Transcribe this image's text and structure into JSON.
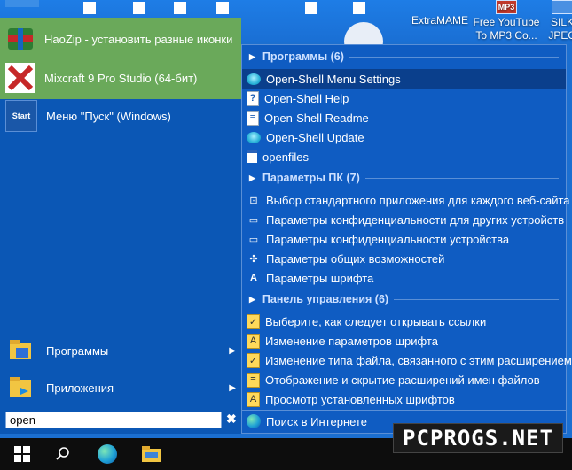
{
  "desktop": {
    "icons": [
      {
        "label": "ExtraMAME",
        "icon": "extramame-icon"
      },
      {
        "label": "Free YouTube To MP3 Co...",
        "icon": "mp3-icon"
      },
      {
        "label": "SILK JPEG P",
        "icon": "silk-icon"
      }
    ],
    "mp3_badge": "MP3"
  },
  "start_menu": {
    "pinned": [
      {
        "label": "HaoZip - установить разные иконки",
        "icon": "haozip-icon"
      },
      {
        "label": "Mixcraft 9 Pro Studio (64-бит)",
        "icon": "mixcraft-icon"
      },
      {
        "label": "Меню \"Пуск\" (Windows)",
        "icon": "start-menu-icon",
        "badge": "Start"
      }
    ],
    "bottom": [
      {
        "label": "Программы",
        "icon": "programs-icon"
      },
      {
        "label": "Приложения",
        "icon": "apps-icon"
      }
    ],
    "search": {
      "value": "open",
      "clear": "✖"
    }
  },
  "results": {
    "sections": [
      {
        "header": "Программы (6)",
        "items": [
          {
            "label": "Open-Shell Menu Settings",
            "icon": "open-shell-icon",
            "selected": true
          },
          {
            "label": "Open-Shell Help",
            "icon": "help-doc-icon"
          },
          {
            "label": "Open-Shell Readme",
            "icon": "readme-doc-icon"
          },
          {
            "label": "Open-Shell Update",
            "icon": "open-shell-update-icon"
          },
          {
            "label": "openfiles",
            "icon": "console-icon"
          }
        ]
      },
      {
        "header": "Параметры ПК (7)",
        "items": [
          {
            "label": "Выбор стандартного приложения для каждого веб-сайта",
            "icon": "default-apps-icon"
          },
          {
            "label": "Параметры конфиденциальности для других устройств",
            "icon": "privacy-icon"
          },
          {
            "label": "Параметры конфиденциальности устройства",
            "icon": "privacy-icon"
          },
          {
            "label": "Параметры общих возможностей",
            "icon": "shared-icon"
          },
          {
            "label": "Параметры шрифта",
            "icon": "font-icon"
          }
        ]
      },
      {
        "header": "Панель управления (6)",
        "items": [
          {
            "label": "Выберите, как следует открывать ссылки",
            "icon": "control-panel-icon"
          },
          {
            "label": "Изменение параметров шрифта",
            "icon": "font-settings-icon"
          },
          {
            "label": "Изменение типа файла, связанного с этим расширением",
            "icon": "file-type-icon"
          },
          {
            "label": "Отображение и скрытие расширений имен файлов",
            "icon": "file-ext-icon"
          },
          {
            "label": "Просмотр установленных шрифтов",
            "icon": "fonts-folder-icon"
          }
        ]
      }
    ],
    "internet_search": {
      "label": "Поиск в Интернете",
      "icon": "edge-icon"
    }
  },
  "taskbar": {
    "items": [
      {
        "name": "windows-start-icon"
      },
      {
        "name": "search-icon"
      },
      {
        "name": "edge-taskbar-icon"
      },
      {
        "name": "explorer-icon"
      }
    ]
  },
  "watermark": "PCPROGS.NET"
}
